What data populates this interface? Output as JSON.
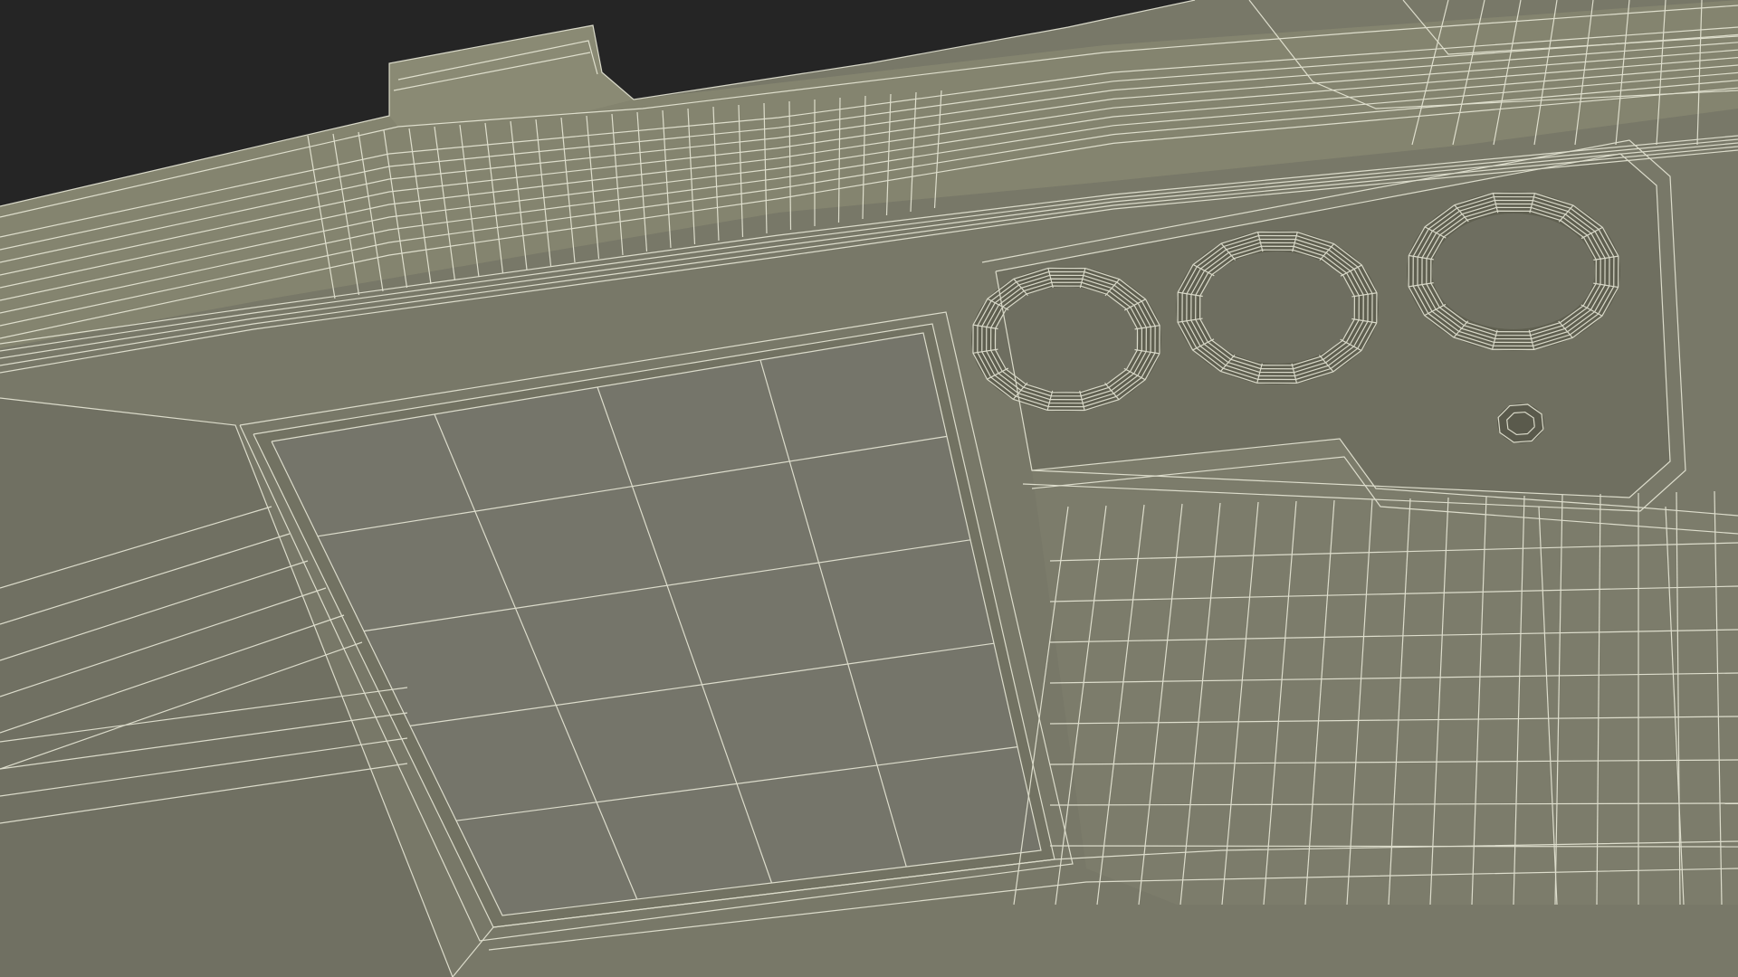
{
  "scene": {
    "subject": "wireframe-3d-render",
    "colors": {
      "background": "#252525",
      "surface": "#787868",
      "surface_light": "#84846f",
      "surface_dark": "#62624f",
      "wire": "#eeeedd",
      "shadow": "#55554a"
    }
  }
}
